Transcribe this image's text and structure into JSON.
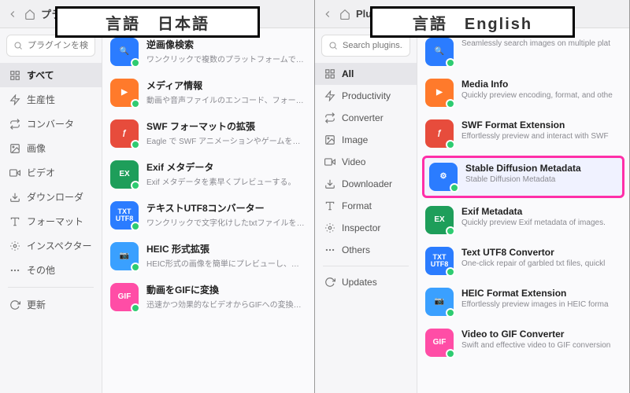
{
  "panes": [
    {
      "banner": "言語　日本語",
      "title": "プラグイン",
      "search_placeholder": "プラグインを検索...",
      "sidebar": [
        {
          "icon": "grid",
          "label": "すべて",
          "selected": true
        },
        {
          "icon": "bolt",
          "label": "生産性",
          "selected": false
        },
        {
          "icon": "convert",
          "label": "コンバータ",
          "selected": false
        },
        {
          "icon": "image",
          "label": "画像",
          "selected": false
        },
        {
          "icon": "video",
          "label": "ビデオ",
          "selected": false
        },
        {
          "icon": "download",
          "label": "ダウンローダ",
          "selected": false
        },
        {
          "icon": "format",
          "label": "フォーマット",
          "selected": false
        },
        {
          "icon": "inspect",
          "label": "インスペクター",
          "selected": false
        },
        {
          "icon": "dots",
          "label": "その他",
          "selected": false
        },
        {
          "icon": "refresh",
          "label": "更新",
          "selected": false
        }
      ],
      "plugins": [
        {
          "icon_class": "ic-blue",
          "glyph": "🔍",
          "title": "逆画像検索",
          "sub": "ワンクリックで複数のプラットフォームで画像をシームレスに",
          "highlight": false
        },
        {
          "icon_class": "ic-orange",
          "glyph": "▶",
          "title": "メディア情報",
          "sub": "動画や音声ファイルのエンコード、フォーマットなどの属性",
          "highlight": false
        },
        {
          "icon_class": "ic-red",
          "glyph": "ƒ",
          "title": "SWF フォーマットの拡張",
          "sub": "Eagle で SWF アニメーションやゲームを簡単にプレビュー",
          "highlight": false
        },
        {
          "icon_class": "ic-green",
          "glyph": "EX",
          "title": "Exif メタデータ",
          "sub": "Exif メタデータを素早くプレビューする。",
          "highlight": false
        },
        {
          "icon_class": "ic-text",
          "glyph": "TXT\nUTF8",
          "title": "テキストUTF8コンバーター",
          "sub": "ワンクリックで文字化けしたtxtファイルを修正し、エンコー",
          "highlight": false
        },
        {
          "icon_class": "ic-sky",
          "glyph": "📷",
          "title": "HEIC 形式拡張",
          "sub": "HEIC形式の画像を簡単にプレビューし、高性能なブラウ",
          "highlight": false
        },
        {
          "icon_class": "ic-pink",
          "glyph": "GIF",
          "title": "動画をGIFに変換",
          "sub": "迅速かつ効果的なビデオからGIFへの変換ツール。",
          "highlight": false
        }
      ]
    },
    {
      "banner": "言語　English",
      "title": "Plugin",
      "search_placeholder": "Search plugins...",
      "sidebar": [
        {
          "icon": "grid",
          "label": "All",
          "selected": true
        },
        {
          "icon": "bolt",
          "label": "Productivity",
          "selected": false
        },
        {
          "icon": "convert",
          "label": "Converter",
          "selected": false
        },
        {
          "icon": "image",
          "label": "Image",
          "selected": false
        },
        {
          "icon": "video",
          "label": "Video",
          "selected": false
        },
        {
          "icon": "download",
          "label": "Downloader",
          "selected": false
        },
        {
          "icon": "format",
          "label": "Format",
          "selected": false
        },
        {
          "icon": "inspect",
          "label": "Inspector",
          "selected": false
        },
        {
          "icon": "dots",
          "label": "Others",
          "selected": false
        },
        {
          "icon": "refresh",
          "label": "Updates",
          "selected": false
        }
      ],
      "plugins": [
        {
          "icon_class": "ic-blue",
          "glyph": "🔍",
          "title": "",
          "sub": "Seamlessly search images on multiple plat",
          "highlight": false
        },
        {
          "icon_class": "ic-orange",
          "glyph": "▶",
          "title": "Media Info",
          "sub": "Quickly preview encoding, format, and othe",
          "highlight": false
        },
        {
          "icon_class": "ic-red",
          "glyph": "ƒ",
          "title": "SWF Format Extension",
          "sub": "Effortlessly preview and interact with SWF",
          "highlight": false
        },
        {
          "icon_class": "ic-blue",
          "glyph": "⚙",
          "title": "Stable Diffusion Metadata",
          "sub": "Stable Diffusion Metadata",
          "highlight": true
        },
        {
          "icon_class": "ic-green",
          "glyph": "EX",
          "title": "Exif Metadata",
          "sub": "Quickly preview Exif metadata of images.",
          "highlight": false
        },
        {
          "icon_class": "ic-text",
          "glyph": "TXT\nUTF8",
          "title": "Text UTF8 Convertor",
          "sub": "One-click repair of garbled txt files, quickl",
          "highlight": false
        },
        {
          "icon_class": "ic-sky",
          "glyph": "📷",
          "title": "HEIC Format Extension",
          "sub": "Effortlessly preview images in HEIC forma",
          "highlight": false
        },
        {
          "icon_class": "ic-pink",
          "glyph": "GIF",
          "title": "Video to GIF Converter",
          "sub": "Swift and effective video to GIF conversion",
          "highlight": false
        }
      ]
    }
  ]
}
